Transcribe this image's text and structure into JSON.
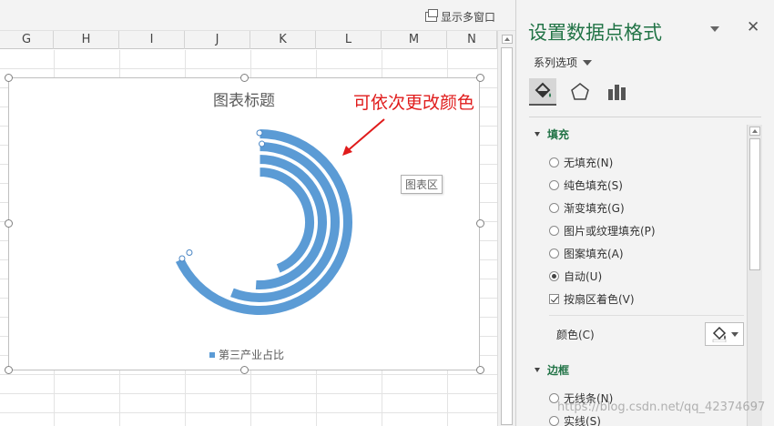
{
  "top_bar": {
    "multi_window_label": "显示多窗口"
  },
  "columns": [
    "G",
    "H",
    "I",
    "J",
    "K",
    "L",
    "M",
    "N"
  ],
  "chart": {
    "title": "图表标题",
    "legend_label": "第三产业占比",
    "tooltip": "图表区",
    "series_color": "#5b9bd5"
  },
  "chart_data": {
    "type": "doughnut",
    "title": "图表标题",
    "series": [
      {
        "name": "第三产业占比",
        "ring": 1,
        "fraction": 0.68
      },
      {
        "name": "第三产业占比",
        "ring": 2,
        "fraction": 0.56
      },
      {
        "name": "第三产业占比",
        "ring": 3,
        "fraction": 0.51
      },
      {
        "name": "第三产业占比",
        "ring": 4,
        "fraction": 0.44
      }
    ],
    "legend": "bottom",
    "color": "#5b9bd5"
  },
  "annotation": {
    "text": "可依次更改颜色",
    "color": "#e01b1b"
  },
  "pane": {
    "title": "设置数据点格式",
    "series_options": "系列选项",
    "fill_section": "填充",
    "fill_options": [
      {
        "label": "无填充(N)",
        "selected": false
      },
      {
        "label": "纯色填充(S)",
        "selected": false
      },
      {
        "label": "渐变填充(G)",
        "selected": false
      },
      {
        "label": "图片或纹理填充(P)",
        "selected": false
      },
      {
        "label": "图案填充(A)",
        "selected": false
      },
      {
        "label": "自动(U)",
        "selected": true
      }
    ],
    "vary_colors": "按扇区着色(V)",
    "color_label": "颜色(C)",
    "border_section": "边框",
    "border_options": [
      {
        "label": "无线条(N)",
        "selected": false
      },
      {
        "label": "实线(S)",
        "selected": false
      }
    ],
    "accent": "#217346"
  },
  "watermark": "https://blog.csdn.net/qq_42374697"
}
